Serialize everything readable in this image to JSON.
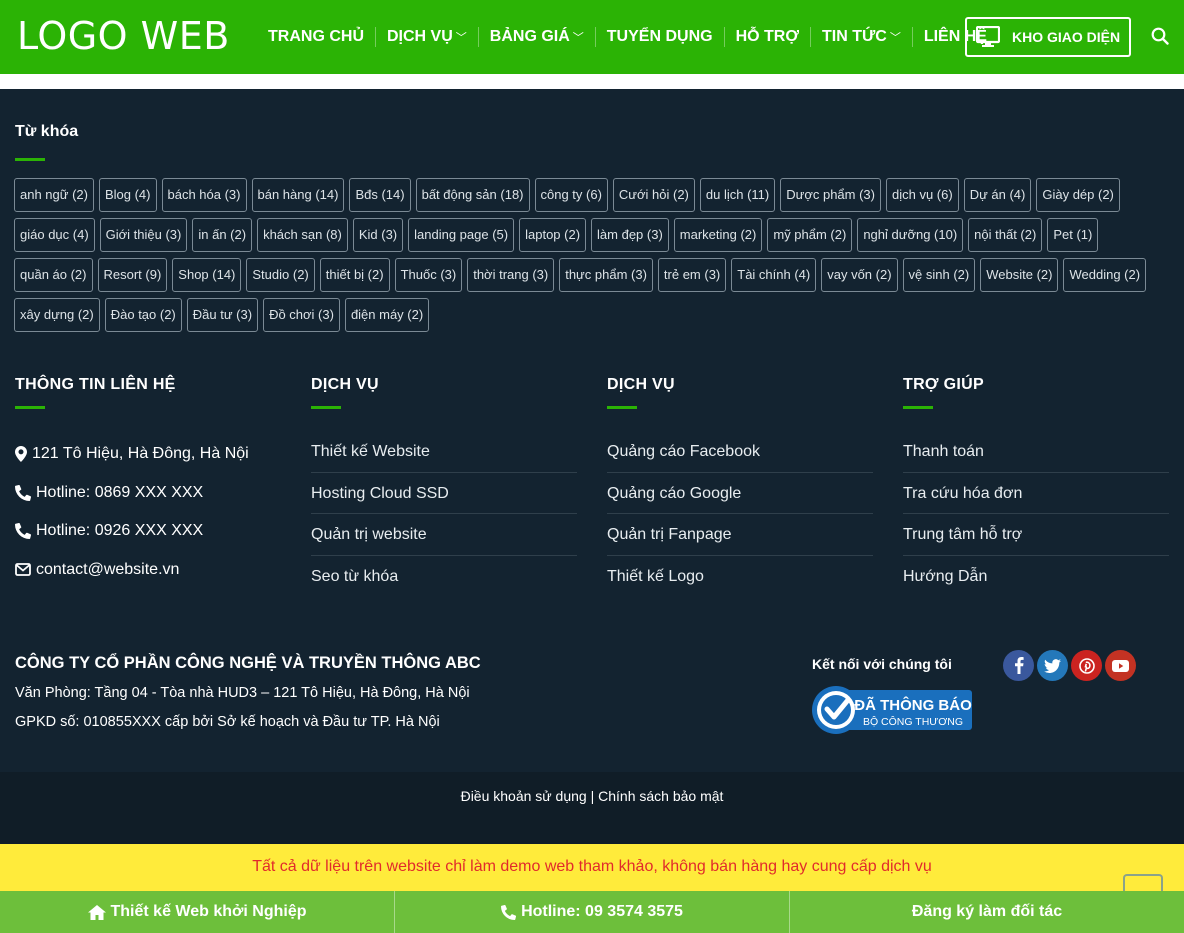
{
  "header": {
    "logo": "LOGO WEB",
    "nav": [
      {
        "label": "TRANG CHỦ",
        "dropdown": false
      },
      {
        "label": "DỊCH VỤ",
        "dropdown": true
      },
      {
        "label": "BẢNG GIÁ",
        "dropdown": true
      },
      {
        "label": "TUYỂN DỤNG",
        "dropdown": false
      },
      {
        "label": "HỖ TRỢ",
        "dropdown": false
      },
      {
        "label": "TIN TỨC",
        "dropdown": true
      },
      {
        "label": "LIÊN HỆ",
        "dropdown": false
      }
    ],
    "kho_button": "KHO GIAO DIỆN",
    "brand_color": "#2bb305"
  },
  "keywords": {
    "title": "Từ khóa",
    "tags": [
      "anh ngữ (2)",
      "Blog (4)",
      "bách hóa (3)",
      "bán hàng (14)",
      "Bđs (14)",
      "bất động sản (18)",
      "công ty (6)",
      "Cưới hỏi (2)",
      "du lịch (11)",
      "Dược phẩm (3)",
      "dịch vụ (6)",
      "Dự án (4)",
      "Giày dép (2)",
      "giáo dục (4)",
      "Giới thiệu (3)",
      "in ấn (2)",
      "khách sạn (8)",
      "Kid (3)",
      "landing page (5)",
      "laptop (2)",
      "làm đẹp (3)",
      "marketing (2)",
      "mỹ phẩm (2)",
      "nghỉ dưỡng (10)",
      "nội thất (2)",
      "Pet (1)",
      "quần áo (2)",
      "Resort (9)",
      "Shop (14)",
      "Studio (2)",
      "thiết bị (2)",
      "Thuốc (3)",
      "thời trang (3)",
      "thực phẩm (3)",
      "trẻ em (3)",
      "Tài chính (4)",
      "vay vốn (2)",
      "vệ sinh (2)",
      "Website (2)",
      "Wedding (2)",
      "xây dựng (2)",
      "Đào tạo (2)",
      "Đầu tư (3)",
      "Đồ chơi (3)",
      "điện máy (2)"
    ]
  },
  "contact": {
    "title": "THÔNG TIN LIÊN HỆ",
    "items": [
      {
        "icon": "map-marker-icon",
        "text": "121 Tô Hiệu, Hà Đông, Hà Nội"
      },
      {
        "icon": "phone-icon",
        "text": "Hotline: 0869 XXX XXX"
      },
      {
        "icon": "phone-icon",
        "text": "Hotline: 0926 XXX XXX"
      },
      {
        "icon": "envelope-icon",
        "text": "contact@website.vn"
      }
    ]
  },
  "services1": {
    "title": "DỊCH VỤ",
    "links": [
      "Thiết kế Website",
      "Hosting Cloud SSD",
      "Quản trị website",
      "Seo từ khóa"
    ]
  },
  "services2": {
    "title": "DỊCH VỤ",
    "links": [
      "Quảng cáo Facebook",
      "Quảng cáo Google",
      "Quản trị Fanpage",
      "Thiết kế Logo"
    ]
  },
  "support": {
    "title": "TRỢ GIÚP",
    "links": [
      "Thanh toán",
      "Tra cứu hóa đơn",
      "Trung tâm hỗ trợ",
      "Hướng Dẫn"
    ]
  },
  "company": {
    "name": "CÔNG TY CỔ PHẦN CÔNG NGHỆ VÀ TRUYỀN THÔNG ABC",
    "office": "Văn Phòng: Tầng 04 - Tòa nhà HUD3 – 121 Tô Hiệu, Hà Đông, Hà Nội",
    "license": "GPKD số: 010855XXX cấp bởi Sở kế hoạch và Đầu tư TP. Hà Nội",
    "connect_title": "Kết nối với chúng tôi",
    "bct_line1": "ĐÃ THÔNG BÁO",
    "bct_line2": "BỘ CÔNG THƯƠNG",
    "socials": [
      {
        "icon": "facebook-icon",
        "color": "#3a589d"
      },
      {
        "icon": "twitter-icon",
        "color": "#2478ba"
      },
      {
        "icon": "pinterest-icon",
        "color": "#cb2320"
      },
      {
        "icon": "youtube-icon",
        "color": "#c33223"
      }
    ]
  },
  "bottom": {
    "terms": "Điều khoản sử dụng",
    "divider": "|",
    "privacy": "Chính sách bảo mật"
  },
  "notice": "Tất cả dữ liệu trên website chỉ làm demo web tham khảo, không bán hàng hay cung cấp dịch vụ",
  "actions": [
    {
      "icon": "home-icon",
      "label": "Thiết kế Web khởi Nghiệp"
    },
    {
      "icon": "phone-icon",
      "label": "Hotline: 09 3574 3575"
    },
    {
      "icon": "",
      "label": "Đăng ký làm đối tác"
    }
  ]
}
